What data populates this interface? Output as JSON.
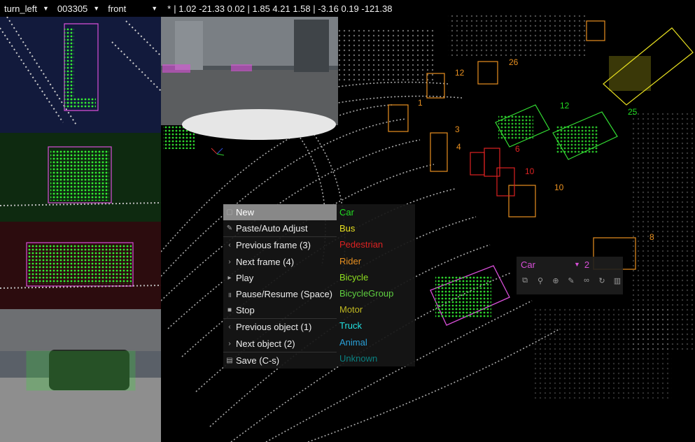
{
  "topbar": {
    "scene": "turn_left",
    "frame": "003305",
    "camera": "front",
    "coords_star": "*",
    "coords": "| 1.02 -21.33 0.02 | 1.85 4.21 1.58 | -3.16 0.19 -121.38"
  },
  "context_menu": {
    "items": [
      {
        "label": "New",
        "icon": "document-icon"
      },
      {
        "label": "Paste/Auto Adjust",
        "icon": "wrench-icon"
      },
      {
        "label": "Previous frame (3)",
        "icon": "chevron-left-icon"
      },
      {
        "label": "Next frame (4)",
        "icon": "chevron-right-icon"
      },
      {
        "label": "Play",
        "icon": "play-icon"
      },
      {
        "label": "Pause/Resume (Space)",
        "icon": "pause-icon"
      },
      {
        "label": "Stop",
        "icon": "stop-icon"
      },
      {
        "label": "Previous object (1)",
        "icon": "chevron-left-icon"
      },
      {
        "label": "Next object (2)",
        "icon": "chevron-right-icon"
      },
      {
        "label": "Save (C-s)",
        "icon": "save-icon"
      }
    ],
    "classes": [
      {
        "label": "Car",
        "color": "#22dd22"
      },
      {
        "label": "Bus",
        "color": "#e8e020"
      },
      {
        "label": "Pedestrian",
        "color": "#dd2222"
      },
      {
        "label": "Rider",
        "color": "#e89020"
      },
      {
        "label": "Bicycle",
        "color": "#8fe020"
      },
      {
        "label": "BicycleGroup",
        "color": "#5fd040"
      },
      {
        "label": "Motor",
        "color": "#c0b820"
      },
      {
        "label": "Truck",
        "color": "#22e0e0"
      },
      {
        "label": "Animal",
        "color": "#2aa0d8"
      },
      {
        "label": "Unknown",
        "color": "#0a8080"
      }
    ]
  },
  "object_panel": {
    "class": "Car",
    "id": "2",
    "tools": [
      "copy-icon",
      "pin-icon",
      "zoom-icon",
      "edit-icon",
      "link-icon",
      "refresh-icon",
      "delete-icon"
    ]
  },
  "box_labels": [
    {
      "text": "12",
      "color": "#e89020"
    },
    {
      "text": "26",
      "color": "#e89020"
    },
    {
      "text": "1",
      "color": "#e89020"
    },
    {
      "text": "3",
      "color": "#e89020"
    },
    {
      "text": "4",
      "color": "#e89020"
    },
    {
      "text": "6",
      "color": "#dd2222"
    },
    {
      "text": "10",
      "color": "#dd2222"
    },
    {
      "text": "10",
      "color": "#e89020"
    },
    {
      "text": "12",
      "color": "#22dd22"
    },
    {
      "text": "25",
      "color": "#22dd22"
    },
    {
      "text": "8",
      "color": "#e89020"
    }
  ],
  "colors": {
    "panel_top": "#121a3c",
    "panel_side": "#0e2a10",
    "panel_back": "#2c0c0e",
    "accent_magenta": "#d84fd8"
  }
}
